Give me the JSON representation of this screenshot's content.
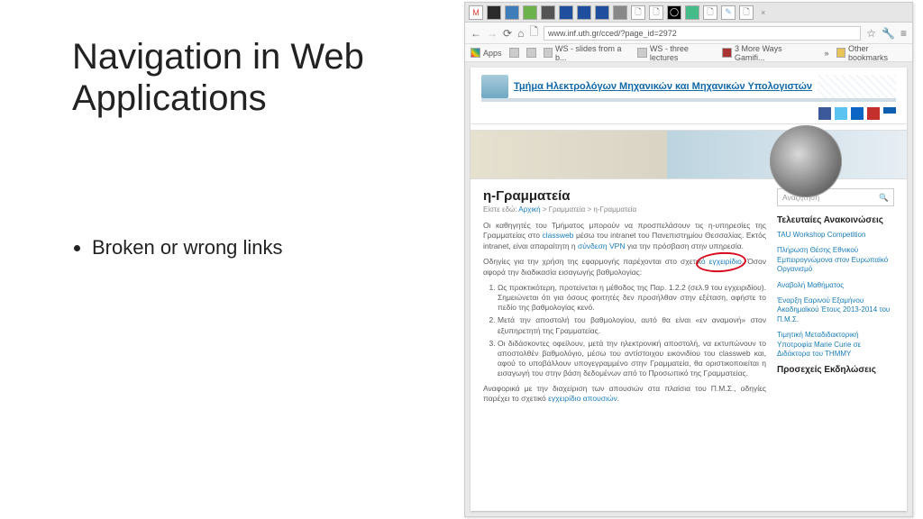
{
  "slide": {
    "title": "Navigation in Web Applications",
    "bullet": "Broken or wrong links"
  },
  "browser": {
    "url": "www.inf.uth.gr/cced/?page_id=2972",
    "tabs": {
      "close": "×"
    },
    "nav": {
      "back": "←",
      "forward": "→",
      "reload": "⟳",
      "home": "⌂",
      "file": "🗋",
      "star": "☆",
      "wrench": "🔧",
      "menu": "≡"
    },
    "bookmarks": {
      "apps": "Apps",
      "items": [
        {
          "label": "WS - slides from a b..."
        },
        {
          "label": "WS - three lectures"
        },
        {
          "label": "3 More Ways Gamifi..."
        }
      ],
      "other": "Other bookmarks"
    }
  },
  "page": {
    "dept_title": "Τμήμα Ηλεκτρολόγων Μηχανικών και Μηχανικών Υπολογιστών",
    "article": {
      "title": "η-Γραμματεία",
      "crumb_prefix": "Είστε εδώ:",
      "crumb_home": "Αρχική",
      "crumb_mid": "Γραμματεία",
      "crumb_leaf": "η-Γραμματεία",
      "p1_a": "Οι καθηγητές του Τμήματος μπορούν να προσπελάσουν τις η-υπηρεσίες της Γραμματείας στο",
      "p1_link1": "classweb",
      "p1_b": "μέσω του intranet του Πανεπιστημίου Θεσσαλίας. Εκτός intranet, είναι απαραίτητη η",
      "p1_link2": "σύνδεση VPN",
      "p1_c": "για την πρόσβαση στην υπηρεσία.",
      "p2_a": "Οδηγίες για την χρήση της εφαρμογής παρέχονται στο σχετικ",
      "p2_circled": "ό εγχειρίδιο.",
      "p2_b": "Όσον αφορά την διαδικασία εισαγωγής βαθμολογίας:",
      "steps": [
        "Ως πρακτικότερη, προτείνεται η μέθοδος της Παρ. 1.2.2 (σελ.9 του εγχειριδίου). Σημειώνεται ότι για όσους φοιτητές δεν προσήλθαν στην εξέταση, αφήστε το πεδίο της βαθμολογίας κενό.",
        "Μετά την αποστολή του βαθμολογίου, αυτό θα είναι «εν αναμονή» στον εξυπηρετητή της Γραμματείας.",
        "Οι διδάσκοντες οφείλουν, μετά την ηλεκτρονική αποστολή, να εκτυπώνουν το αποστολθέν βαθμολόγιο, μέσω του αντίστοιχου εικονιδίου του classweb και, αφού το υποβάλλουν υπογεγραμμένο στην Γραμματεία, θα οριστικοποιείται η εισαγωγή του στην βάση δεδομένων από το Προσωπικό της Γραμματείας."
      ],
      "p3_a": "Αναφορικά με την διαχείριση των απουσιών στα πλαίσια του Π.Μ.Σ., οδηγίες παρέχει το σχετικό",
      "p3_link": "εγχειρίδιο απουσιών",
      "p3_b": "."
    },
    "sidebar": {
      "search_placeholder": "Αναζήτηση",
      "h1": "Τελευταίες Ανακοινώσεις",
      "links": [
        "TAU Workshop Competition",
        "Πλήρωση Θέσης Εθνικού Εμπειρογνώμονα στον Ευρωπαϊκό Οργανισμό",
        "Αναβολή Μαθήματος",
        "Έναρξη Εαρινού Εξαμήνου Ακαδημαϊκού Έτους 2013-2014 του Π.Μ.Σ.",
        "Τιμητική Μεταδιδακτορική Υποτροφία Marie Curie σε Διδάκτορα του ΤΗΜΜΥ"
      ],
      "h2": "Προσεχείς Εκδηλώσεις"
    }
  }
}
